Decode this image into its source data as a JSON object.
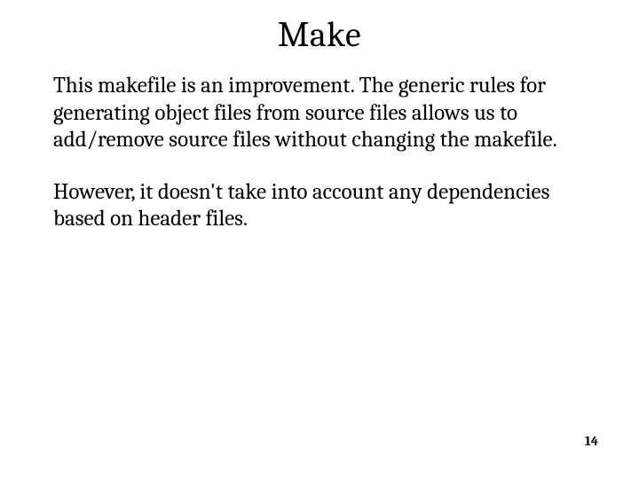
{
  "slide": {
    "title": "Make",
    "paragraph1": "This makefile is an improvement. The generic rules for generating object files from source files allows us to add/remove source files without changing the makefile.",
    "paragraph2": "However, it doesn't take into account any dependencies based on header files.",
    "page_number": "14"
  }
}
